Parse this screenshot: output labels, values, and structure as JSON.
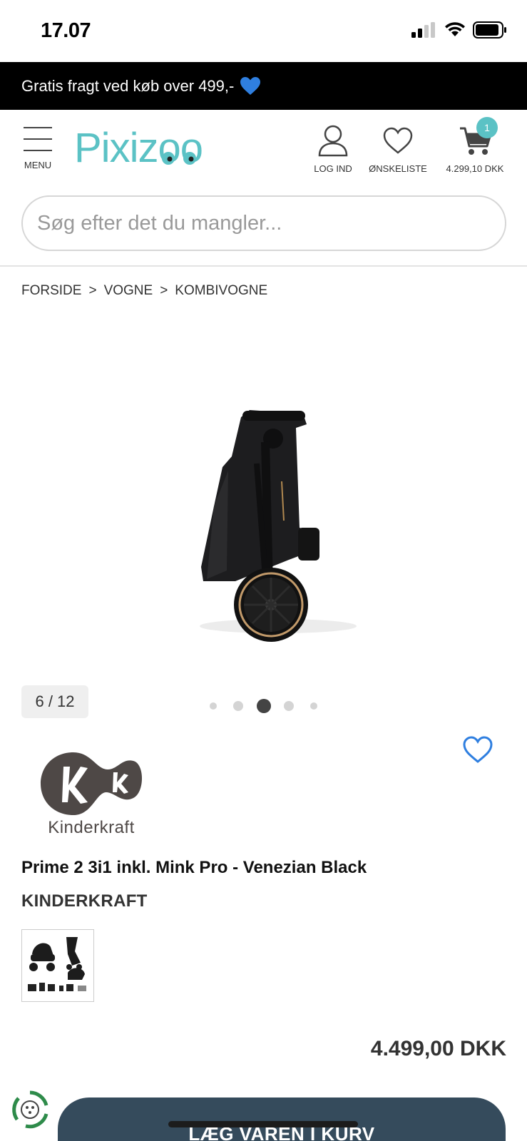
{
  "status_bar": {
    "time": "17.07"
  },
  "promo": {
    "text": "Gratis fragt ved køb over 499,-",
    "emoji": "blue-heart"
  },
  "header": {
    "menu_label": "MENU",
    "logo": "Pixizoo",
    "login_label": "LOG IND",
    "wishlist_label": "ØNSKELISTE",
    "cart_total": "4.299,10 DKK",
    "cart_count": "1",
    "accent_color": "#5bc2c5"
  },
  "search": {
    "placeholder": "Søg efter det du mangler..."
  },
  "breadcrumb": {
    "items": [
      "FORSIDE",
      "VOGNE",
      "KOMBIVOGNE"
    ],
    "separator": ">"
  },
  "gallery": {
    "counter": "6 / 12",
    "active_dot": 3,
    "dot_count": 5
  },
  "product": {
    "brand_logo_text": "Kinderkraft",
    "title": "Prime 2 3i1 inkl. Mink Pro - Venezian Black",
    "brand": "KINDERKRAFT",
    "price": "4.499,00 DKK",
    "add_to_cart_label": "LÆG VAREN I KURV"
  }
}
